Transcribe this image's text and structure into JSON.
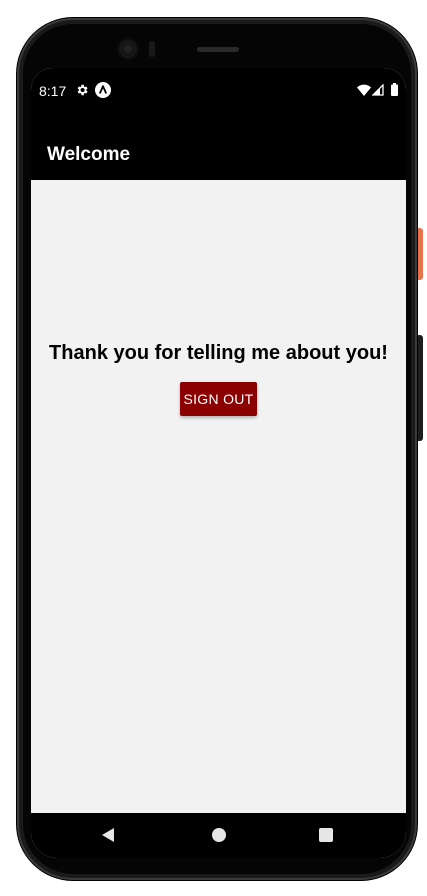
{
  "status_bar": {
    "time": "8:17",
    "icons": [
      "settings-gear-icon",
      "app-a-icon",
      "wifi-icon",
      "signal-icon",
      "battery-icon"
    ]
  },
  "app_bar": {
    "title": "Welcome"
  },
  "main": {
    "message": "Thank you for telling me about you!",
    "sign_out_label": "SIGN OUT"
  },
  "nav_bar": {
    "icons": [
      "back-icon",
      "home-icon",
      "recents-icon"
    ]
  },
  "colors": {
    "status_bar_bg": "#000000",
    "app_bar_bg": "#000000",
    "content_bg": "#f2f2f2",
    "button_bg": "#8b0000",
    "button_text": "#ffffff"
  }
}
